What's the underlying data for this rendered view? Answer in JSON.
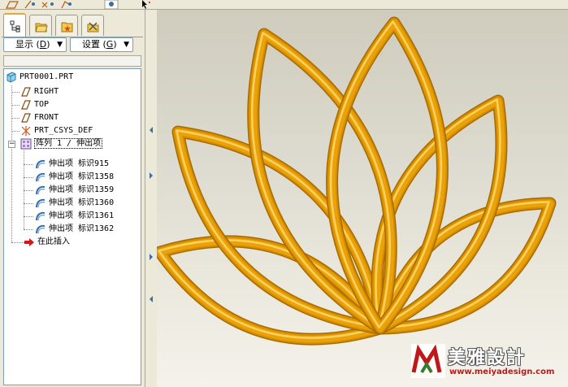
{
  "toolbar": {
    "buttons": [
      "datum-planes-toggle",
      "datum-axes-toggle",
      "datum-points-toggle",
      "csys-toggle",
      "spin-center-toggle",
      "select-cursor"
    ]
  },
  "navigator": {
    "tabs": [
      "model-tree-tab",
      "folder-browser-tab",
      "favorites-tab",
      "connections-tab"
    ],
    "show_label": "显示 (",
    "show_key": "D",
    "show_suffix": ")",
    "settings_label": "设置 (",
    "settings_key": "G",
    "settings_suffix": ")"
  },
  "tree": {
    "root": "PRT0001.PRT",
    "datums": [
      "RIGHT",
      "TOP",
      "FRONT",
      "PRT_CSYS_DEF"
    ],
    "pattern": "阵列 1 / 伸出项",
    "features": [
      "伸出项 标识915",
      "伸出项 标识1358",
      "伸出项 标识1359",
      "伸出项 标识1360",
      "伸出项 标识1361",
      "伸出项 标识1362"
    ],
    "insert_here": "在此插入"
  },
  "watermark": {
    "title": "美雅設計",
    "url": "www.meiyadesign.com"
  },
  "colors": {
    "model_gold": "#e9a20a",
    "model_shadow": "#a86a00",
    "model_highlight": "#ffd15c",
    "accent_red": "#c01818"
  }
}
